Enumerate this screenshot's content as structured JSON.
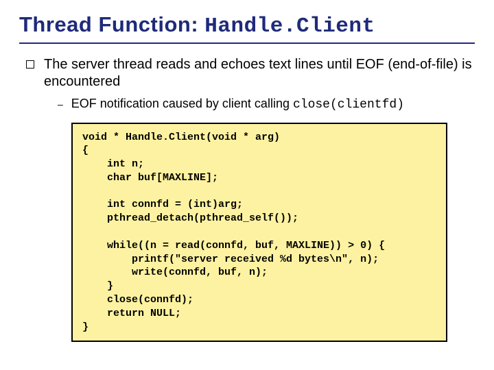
{
  "title": {
    "prefix": "Thread Function: ",
    "code": "Handle.Client"
  },
  "bullet": {
    "text": "The server thread reads and echoes text lines until EOF (end-of-file) is encountered"
  },
  "subbullet": {
    "prefix": "EOF notification caused by client calling ",
    "code": "close(clientfd)"
  },
  "code": "void * Handle.Client(void * arg)\n{\n    int n;\n    char buf[MAXLINE];\n\n    int connfd = (int)arg;\n    pthread_detach(pthread_self());\n\n    while((n = read(connfd, buf, MAXLINE)) > 0) {\n        printf(\"server received %d bytes\\n\", n);\n        write(connfd, buf, n);\n    }\n    close(connfd);\n    return NULL;\n}"
}
